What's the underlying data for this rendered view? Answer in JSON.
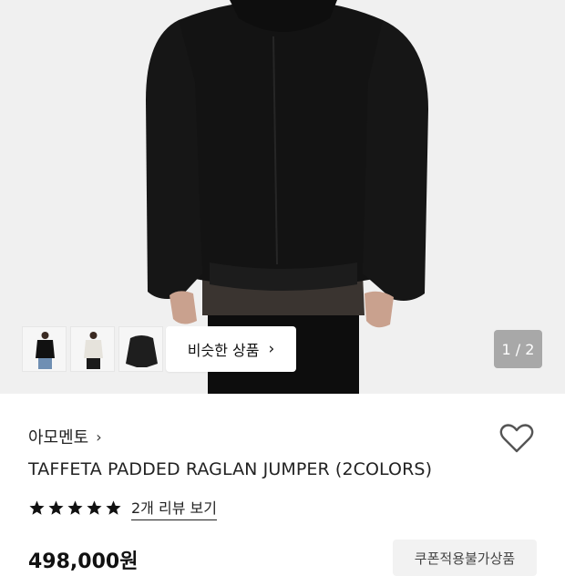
{
  "gallery": {
    "similar_label": "비슷한 상품",
    "counter": "1 / 2",
    "thumbnails": [
      "product-thumb-black",
      "product-thumb-white",
      "product-thumb-jacket"
    ]
  },
  "product": {
    "brand": "아모멘토",
    "title": "TAFFETA PADDED RAGLAN JUMPER (2COLORS)",
    "rating": 5,
    "review_link": "2개 리뷰 보기",
    "price": "498,000원",
    "coupon_badge": "쿠폰적용불가상품"
  },
  "icons": {
    "brand_arrow": "chevron-right-icon",
    "similar_arrow": "chevron-right-icon",
    "wishlist": "heart-icon",
    "star": "star-icon"
  },
  "colors": {
    "text": "#111111",
    "hero_bg": "#f0f0f0",
    "badge_bg": "#f2f2f2",
    "counter_bg": "#6e6e6e"
  }
}
